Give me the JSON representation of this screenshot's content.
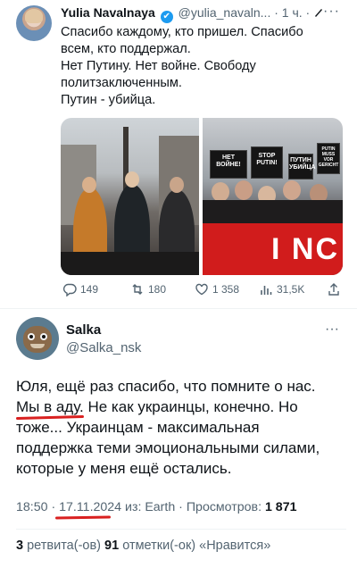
{
  "tweet": {
    "author_name": "Yulia Navalnaya",
    "verified_mark": "✔",
    "handle_time": "@yulia_navaln... · 1 ч. ·",
    "more": "···",
    "lines": [
      "Спасибо каждому, кто пришел. Спасибо",
      "всем, кто поддержал.",
      "Нет Путину. Нет войне. Свободу",
      "политзаключенным.",
      "Путин - убийца."
    ],
    "photo_texts": {
      "sign_left": "НЕТ ВОЙНЕ!",
      "sign_stop": "STOP PUTIN!",
      "sign_right": "ПУТИН УБИЙЦА",
      "sign_small": "PUTIN MUSS VOR GERICHT",
      "banner": "I NC"
    },
    "actions": {
      "replies": "149",
      "retweets": "180",
      "likes": "1 358",
      "views": "31,5K"
    }
  },
  "reply": {
    "author_name": "Salka",
    "handle": "@Salka_nsk",
    "more": "···",
    "lines": [
      "Юля, ещё раз спасибо,  что помните о нас.",
      "Мы в аду. Не как украинцы, конечно. Но",
      "тоже... Украинцам - максимальная",
      "поддержка теми эмоциональными силами,",
      "которые у меня ещё остались."
    ],
    "meta_time": "18:50 · ",
    "meta_date": "17.11.2024",
    "meta_source": " из: Earth · Просмотров: ",
    "meta_views": "1 871",
    "stats_retweets_count": "3",
    "stats_retweets_label": " ретвита(-ов) ",
    "stats_likes_count": "91",
    "stats_likes_label": " отметки(-ок) «Нравится»"
  },
  "colors": {
    "verified": "#1d9bf0",
    "muted": "#536471",
    "annotation_underline": "#d92020",
    "banner_red": "#d11c1c"
  }
}
